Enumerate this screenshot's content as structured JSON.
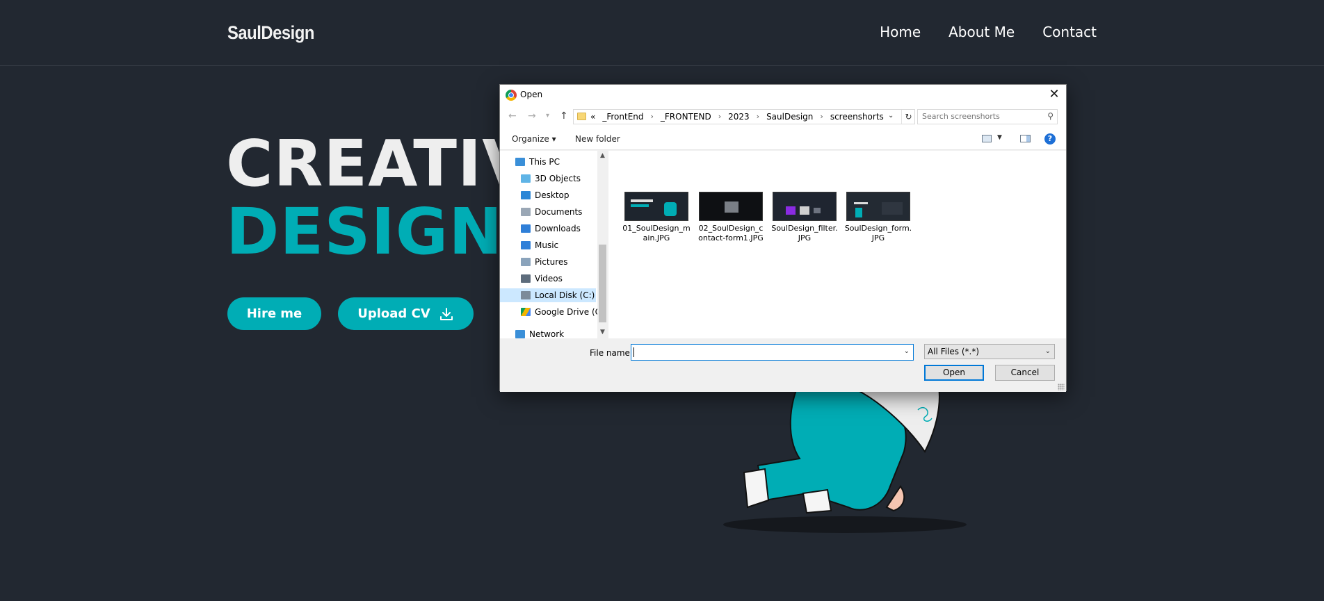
{
  "site": {
    "logo": "SaulDesign",
    "nav": [
      "Home",
      "About Me",
      "Contact"
    ],
    "hero_line1": "CREATIVE",
    "hero_line2": "DESIGNER",
    "hire_label": "Hire me",
    "upload_label": "Upload CV",
    "accent": "#00adb5",
    "background": "#222831"
  },
  "dialog": {
    "title": "Open",
    "breadcrumb": [
      "«",
      "_FrontEnd",
      "_FRONTEND",
      "2023",
      "SaulDesign",
      "screenshorts"
    ],
    "search_placeholder": "Search screenshorts",
    "organize_label": "Organize ▾",
    "new_folder_label": "New folder",
    "help_label": "?",
    "nav_items": [
      {
        "label": "This PC",
        "icon": "pc-icon",
        "color": "#3a8fd8"
      },
      {
        "label": "3D Objects",
        "icon": "cube-icon",
        "color": "#5fb4e6"
      },
      {
        "label": "Desktop",
        "icon": "desktop-icon",
        "color": "#2b86d6"
      },
      {
        "label": "Documents",
        "icon": "documents-icon",
        "color": "#9aa7b5"
      },
      {
        "label": "Downloads",
        "icon": "downloads-icon",
        "color": "#2f7fd8"
      },
      {
        "label": "Music",
        "icon": "music-icon",
        "color": "#2f7fd8"
      },
      {
        "label": "Pictures",
        "icon": "pictures-icon",
        "color": "#8aa3bb"
      },
      {
        "label": "Videos",
        "icon": "videos-icon",
        "color": "#5d6c7c"
      },
      {
        "label": "Local Disk (C:)",
        "icon": "disk-icon",
        "color": "#7d8b99"
      },
      {
        "label": "Google Drive (G:",
        "icon": "google-drive-icon",
        "color": "#f4b400"
      },
      {
        "label": "Network",
        "icon": "network-icon",
        "color": "#3a8fd8"
      }
    ],
    "files": [
      {
        "name": "01_SoulDesign_main.JPG"
      },
      {
        "name": "02_SoulDesign_contact-form1.JPG"
      },
      {
        "name": "SoulDesign_filter.JPG"
      },
      {
        "name": "SoulDesign_form.JPG"
      }
    ],
    "file_name_label": "File name:",
    "file_name_value": "",
    "filter_value": "All Files (*.*)",
    "open_label": "Open",
    "cancel_label": "Cancel"
  }
}
